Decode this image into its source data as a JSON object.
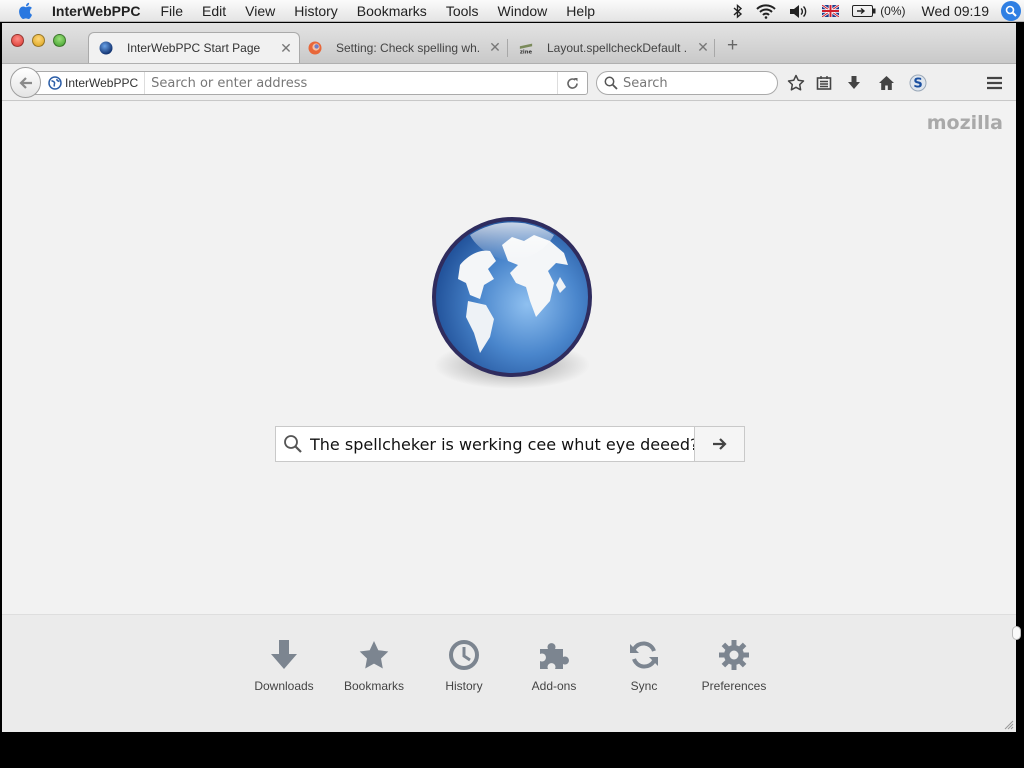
{
  "menubar": {
    "app_name": "InterWebPPC",
    "items": [
      "File",
      "Edit",
      "View",
      "History",
      "Bookmarks",
      "Tools",
      "Window",
      "Help"
    ],
    "battery": "(0%)",
    "clock": "Wed 09:19",
    "icons": [
      "apple-icon",
      "bluetooth-icon",
      "wifi-icon",
      "volume-icon",
      "uk-flag-icon",
      "battery-icon",
      "spotlight-icon"
    ]
  },
  "tabs": [
    {
      "label": "InterWebPPC Start Page",
      "icon": "globe-icon",
      "active": true
    },
    {
      "label": "Setting: Check spelling wh...",
      "icon": "firefox-icon",
      "active": false
    },
    {
      "label": "Layout.spellcheckDefault ...",
      "icon": "zine-icon",
      "active": false
    }
  ],
  "navbar": {
    "identity": "InterWebPPC",
    "url_placeholder": "Search or enter address",
    "search_placeholder": "Search"
  },
  "content": {
    "brand": "mozilla",
    "search_text": [
      "The",
      "spellcheker",
      "is",
      "werking",
      "cee",
      "whut",
      "eye",
      "deeed?"
    ],
    "launcher": [
      {
        "label": "Downloads",
        "icon": "download-icon"
      },
      {
        "label": "Bookmarks",
        "icon": "star-icon"
      },
      {
        "label": "History",
        "icon": "clock-icon"
      },
      {
        "label": "Add-ons",
        "icon": "puzzle-icon"
      },
      {
        "label": "Sync",
        "icon": "sync-icon"
      },
      {
        "label": "Preferences",
        "icon": "gear-icon"
      }
    ]
  },
  "colors": {
    "accent": "#2f7fe3",
    "spell_error": "#d02020",
    "launcher_icon": "#7c8590"
  }
}
